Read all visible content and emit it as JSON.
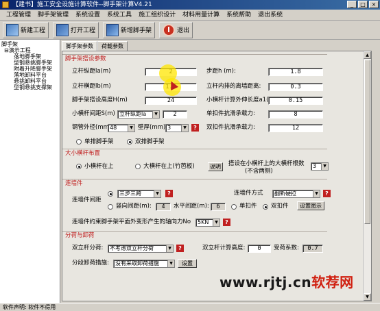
{
  "window": {
    "title": "【建书】施工安全设施计算软件--脚手架计算V4.21",
    "buttons": [
      "_",
      "□",
      "×"
    ]
  },
  "menubar": {
    "items": [
      "工程管理",
      "脚手架管理",
      "系统设置",
      "系统工具",
      "施工组织设计",
      "材料用量计算",
      "系统帮助",
      "退出系统"
    ]
  },
  "toolbar": {
    "new_label": "新建工程",
    "open_label": "打开工程",
    "add_label": "新增脚手架",
    "exit_label": "退出"
  },
  "tree": {
    "root": "脚手架",
    "items": [
      {
        "label": "演示工程",
        "level": 1
      },
      {
        "label": "落地脚手架",
        "level": 2
      },
      {
        "label": "型钢悬挑脚手架",
        "level": 2
      },
      {
        "label": "附着升降脚手架",
        "level": 2
      },
      {
        "label": "落地卸料平台",
        "level": 2
      },
      {
        "label": "悬挑卸料平台",
        "level": 2
      },
      {
        "label": "型钢悬挑支撑架",
        "level": 2
      }
    ]
  },
  "tabs": [
    "脚手架参数",
    "荷载参数"
  ],
  "sections": {
    "setup": "脚手架搭设参数",
    "small_crossbar": "大小横杆布置",
    "wall_tie": "连墙件",
    "unloading": "分荷与卸荷"
  },
  "params": {
    "la_label": "立杆纵距la(m)",
    "la_value": "2",
    "lb_label": "立杆横距lb(m)",
    "lb_value": "1.0",
    "h_label": "脚手架搭设高度H(m)",
    "h_value": "24",
    "step_label": "步距h (m):",
    "step_value": "1.8",
    "inner_label": "立杆内排的离墙距离:",
    "inner_value": "0.3",
    "ext_label": "小横杆计算外伸长度a1(m):",
    "ext_value": "0.15",
    "spacing_label": "小横杆间距S(m)",
    "spacing_mode": "立杆纵距la",
    "spacing_value": "2",
    "single_clip_label": "单扣件抗滑承载力:",
    "single_clip_value": "8",
    "double_clip_label": "双扣件抗滑承载力:",
    "double_clip_value": "12",
    "pipe_label": "钢管外径(mm)",
    "pipe_value": "48",
    "wall_thk_label": "壁厚(mm)",
    "wall_thk_value": "3",
    "single_row": "单排脚手架",
    "double_row": "双排脚手架"
  },
  "crossbar": {
    "small_on_top": "小横杆在上",
    "large_on_top": "大横杆在上(竹芭板)",
    "explain_btn": "说明",
    "count_label": "搭设在小横杆上的大横杆根数",
    "count_sub": "(不含两侧)",
    "count_value": "3"
  },
  "wall": {
    "spacing_label": "连墙件间距",
    "spacing_mode": "三步三跨",
    "method_label": "连墙件方式",
    "method_value": "翻新硬拉",
    "vertical_label": "竖向间距(m):",
    "vertical_value": "4",
    "horizontal_label": "水平间距(m):",
    "horizontal_value": "6",
    "single_clip": "单扣件",
    "double_clip": "双扣件",
    "diagram_btn": "设置图示",
    "axial_label": "连墙件约束脚手架平面外变形产生的轴向力No",
    "axial_value": "5KN"
  },
  "unload": {
    "double_split_label": "双立杆分荷:",
    "double_split_value": "不考虑双立杆分荷",
    "calc_height_label": "双立杆计算高度:",
    "calc_height_value": "0",
    "coef_label": "受荷系数:",
    "coef_value": "0.7",
    "measure_label": "分段卸荷措施:",
    "measure_value": "没有采取卸荷措施",
    "setup_btn": "设置"
  },
  "status": {
    "text": "软件声明: 软件不得用"
  },
  "watermark": {
    "text": "www.rjtj.cn",
    "accent": "软荐网"
  }
}
